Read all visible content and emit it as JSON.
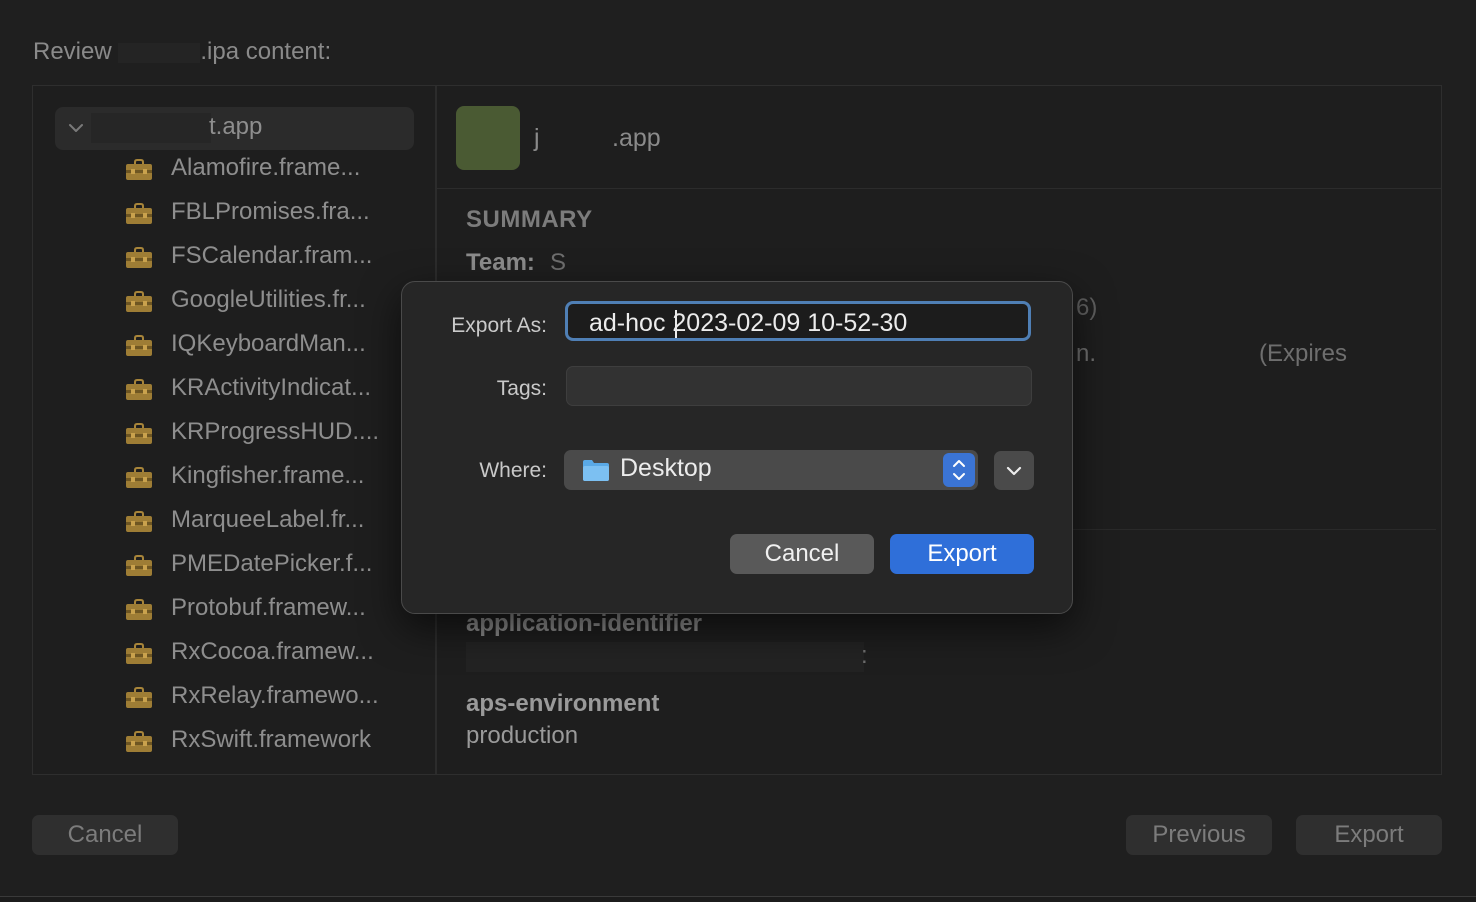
{
  "window": {
    "review_prefix": "Review ",
    "review_suffix": ".ipa content:"
  },
  "sidebar": {
    "app_item": {
      "label": "t.app"
    },
    "frameworks": [
      "Alamofire.frame...",
      "FBLPromises.fra...",
      "FSCalendar.fram...",
      "GoogleUtilities.fr...",
      "IQKeyboardMan...",
      "KRActivityIndicat...",
      "KRProgressHUD....",
      "Kingfisher.frame...",
      "MarqueeLabel.fr...",
      "PMEDatePicker.f...",
      "Protobuf.framew...",
      "RxCocoa.framew...",
      "RxRelay.framewo...",
      "RxSwift.framework"
    ],
    "framework_icon": "toolbox-icon"
  },
  "detail": {
    "app_name_start": "j",
    "app_name_end": ".app",
    "summary_heading": "SUMMARY",
    "team_label": "Team:",
    "team_value": "S",
    "line2_fragment": "6)",
    "line3_fragment": "n.",
    "expires_fragment": "(Expires",
    "entitlements": [
      {
        "key": "application-identifier",
        "value": ":"
      },
      {
        "key": "aps-environment",
        "value": "production"
      }
    ]
  },
  "footer": {
    "cancel_label": "Cancel",
    "previous_label": "Previous",
    "export_label": "Export"
  },
  "sheet": {
    "export_as_label": "Export As:",
    "export_as_value": "ad-hoc 2023-02-09 10-52-30",
    "tags_label": "Tags:",
    "tags_value": "",
    "where_label": "Where:",
    "where_value": "Desktop",
    "cancel_label": "Cancel",
    "export_label": "Export",
    "accent_color": "#2f6fd9"
  }
}
